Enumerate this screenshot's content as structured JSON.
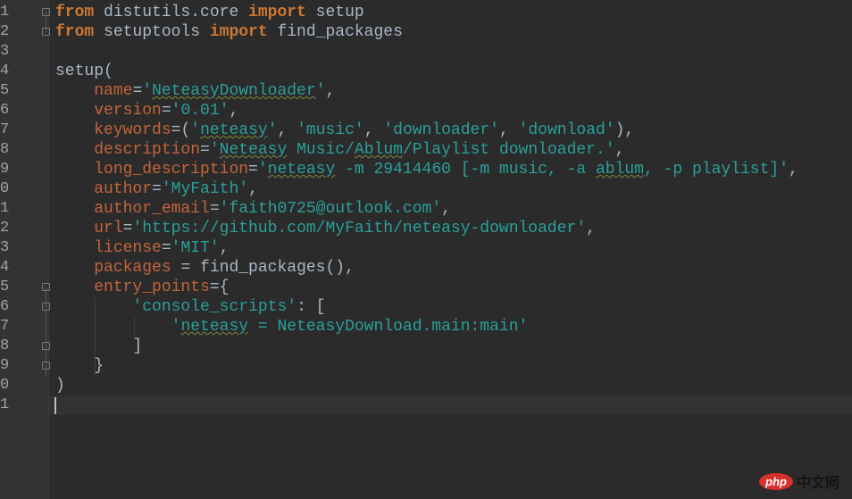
{
  "editor": {
    "line_numbers": [
      "1",
      "2",
      "3",
      "4",
      "5",
      "6",
      "7",
      "8",
      "9",
      "0",
      "1"
    ],
    "lines": [
      [
        [
          "kw",
          "from"
        ],
        [
          "t",
          " distutils.core "
        ],
        [
          "kw",
          "import"
        ],
        [
          "t",
          " setup"
        ]
      ],
      [
        [
          "kw",
          "from"
        ],
        [
          "t",
          " setuptools "
        ],
        [
          "kw",
          "import"
        ],
        [
          "t",
          " find_packages"
        ]
      ],
      [],
      [
        [
          "t",
          "setup("
        ]
      ],
      [
        [
          "t",
          "    "
        ],
        [
          "param",
          "name"
        ],
        [
          "t",
          "="
        ],
        [
          "str",
          "'"
        ],
        [
          "strw",
          "NeteasyDownloader"
        ],
        [
          "str",
          "'"
        ],
        [
          "t",
          ","
        ]
      ],
      [
        [
          "t",
          "    "
        ],
        [
          "param",
          "version"
        ],
        [
          "t",
          "="
        ],
        [
          "str",
          "'0.01'"
        ],
        [
          "t",
          ","
        ]
      ],
      [
        [
          "t",
          "    "
        ],
        [
          "param",
          "keywords"
        ],
        [
          "t",
          "=("
        ],
        [
          "str",
          "'"
        ],
        [
          "strw",
          "neteasy"
        ],
        [
          "str",
          "'"
        ],
        [
          "t",
          ", "
        ],
        [
          "str",
          "'music'"
        ],
        [
          "t",
          ", "
        ],
        [
          "str",
          "'downloader'"
        ],
        [
          "t",
          ", "
        ],
        [
          "str",
          "'download'"
        ],
        [
          "t",
          "),"
        ]
      ],
      [
        [
          "t",
          "    "
        ],
        [
          "param",
          "description"
        ],
        [
          "t",
          "="
        ],
        [
          "str",
          "'"
        ],
        [
          "strw",
          "Neteasy"
        ],
        [
          "str",
          " Music/"
        ],
        [
          "strw",
          "Ablum"
        ],
        [
          "str",
          "/Playlist downloader.'"
        ],
        [
          "t",
          ","
        ]
      ],
      [
        [
          "t",
          "    "
        ],
        [
          "param",
          "long_description"
        ],
        [
          "t",
          "="
        ],
        [
          "str",
          "'"
        ],
        [
          "strw",
          "neteasy"
        ],
        [
          "str",
          " -m 29414460 [-m music, -a "
        ],
        [
          "strw",
          "ablum"
        ],
        [
          "str",
          ", -p playlist]'"
        ],
        [
          "t",
          ","
        ]
      ],
      [
        [
          "t",
          "    "
        ],
        [
          "param",
          "author"
        ],
        [
          "t",
          "="
        ],
        [
          "str",
          "'MyFaith'"
        ],
        [
          "t",
          ","
        ]
      ],
      [
        [
          "t",
          "    "
        ],
        [
          "param",
          "author_email"
        ],
        [
          "t",
          "="
        ],
        [
          "str",
          "'faith0725@outlook.com'"
        ],
        [
          "t",
          ","
        ]
      ],
      [
        [
          "t",
          "    "
        ],
        [
          "param",
          "url"
        ],
        [
          "t",
          "="
        ],
        [
          "str",
          "'https://github.com/MyFaith/neteasy-downloader'"
        ],
        [
          "t",
          ","
        ]
      ],
      [
        [
          "t",
          "    "
        ],
        [
          "param",
          "license"
        ],
        [
          "t",
          "="
        ],
        [
          "str",
          "'MIT'"
        ],
        [
          "t",
          ","
        ]
      ],
      [
        [
          "t",
          "    "
        ],
        [
          "param",
          "packages"
        ],
        [
          "t",
          " = find_packages(),"
        ]
      ],
      [
        [
          "t",
          "    "
        ],
        [
          "param",
          "entry_points"
        ],
        [
          "t",
          "={"
        ]
      ],
      [
        [
          "t",
          "        "
        ],
        [
          "str",
          "'console_scripts'"
        ],
        [
          "t",
          ": ["
        ]
      ],
      [
        [
          "t",
          "            "
        ],
        [
          "str",
          "'"
        ],
        [
          "strw",
          "neteasy"
        ],
        [
          "str",
          " = NeteasyDownload.main:main'"
        ]
      ],
      [
        [
          "t",
          "        ]"
        ]
      ],
      [
        [
          "t",
          "    }"
        ]
      ],
      [
        [
          "t",
          ")"
        ]
      ],
      []
    ],
    "gutter_numbers_all": [
      "1",
      "2",
      "3",
      "4",
      "5",
      "6",
      "7",
      "8",
      "9",
      "0",
      "1",
      "2",
      "3",
      "4",
      "5",
      "6",
      "7",
      "8",
      "9",
      "0",
      "1"
    ]
  },
  "watermark": {
    "logo": "php",
    "text": "中文网"
  }
}
